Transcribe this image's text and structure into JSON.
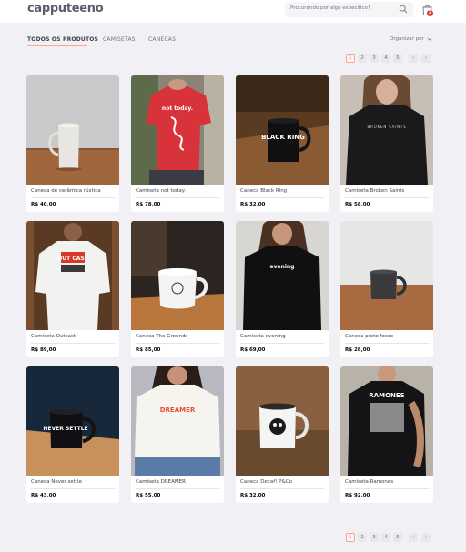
{
  "header": {
    "logo": "capputeeno",
    "search_placeholder": "Procurando por algo específico?",
    "cart_count": "2"
  },
  "filters": {
    "tabs": [
      {
        "label": "TODOS OS PRODUTOS",
        "active": true
      },
      {
        "label": "CAMISETAS",
        "active": false
      },
      {
        "label": "CANECAS",
        "active": false
      }
    ],
    "sort_label": "Organizar por"
  },
  "pagination": {
    "pages": [
      "1",
      "2",
      "3",
      "4",
      "5"
    ],
    "active": "1",
    "prev": "‹",
    "next": "›"
  },
  "colors": {
    "accent": "#ffa585",
    "background": "#f0f0f5",
    "badge": "#de3838"
  },
  "products": [
    {
      "name": "Caneca de cerâmica rústica",
      "price": "R$ 40,00"
    },
    {
      "name": "Camiseta not today.",
      "price": "R$ 78,00"
    },
    {
      "name": "Caneca Black Ring",
      "price": "R$ 32,00"
    },
    {
      "name": "Camiseta Broken Saints",
      "price": "R$ 58,00"
    },
    {
      "name": "Camiseta Outcast",
      "price": "R$ 89,00"
    },
    {
      "name": "Caneca The Grounds",
      "price": "R$ 85,00"
    },
    {
      "name": "Camiseta evening",
      "price": "R$ 69,00"
    },
    {
      "name": "Caneca preto fosco",
      "price": "R$ 28,00"
    },
    {
      "name": "Caneca Never settle",
      "price": "R$ 43,00"
    },
    {
      "name": "Camiseta DREAMER",
      "price": "R$ 55,00"
    },
    {
      "name": "Caneca Decaf! P&Co",
      "price": "R$ 32,00"
    },
    {
      "name": "Camiseta Ramones",
      "price": "R$ 92,00"
    }
  ],
  "image_text": {
    "not_today": "not today.",
    "black_ring": "BLACK RING",
    "broken_saints": "BROKEN SAINTS",
    "outcast": "OUT CAST",
    "evening": "evening",
    "never_settle": "NEVER SETTLE",
    "dreamer": "DREAMER",
    "ramones": "RAMONES"
  }
}
